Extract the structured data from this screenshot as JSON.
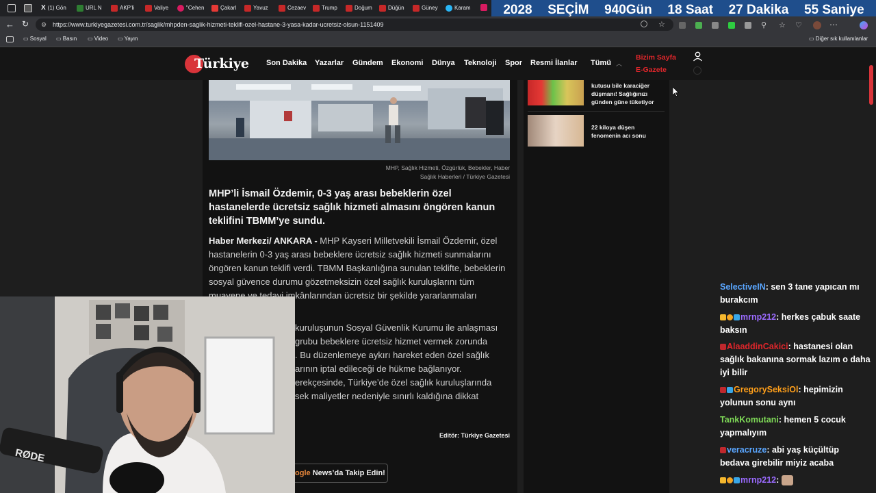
{
  "browser": {
    "tabs": [
      "(1) Gön",
      "URL N",
      "AKP'li",
      "Valiye",
      "\"Cehen",
      "Çakarl",
      "Yavuz",
      "Cezaev",
      "Trump",
      "Doğum",
      "Düğün",
      "Güney",
      "Karam"
    ],
    "url": "https://www.turkiyegazetesi.com.tr/saglik/mhpden-saglik-hizmeti-teklifi-ozel-hastane-3-yasa-kadar-ucretsiz-olsun-1151409",
    "bookmarks": [
      "Sosyal",
      "Basın",
      "Video",
      "Yayın"
    ],
    "other_bookmarks": "Diğer sık kullanılanlar"
  },
  "countdown": {
    "year": "2028",
    "label": "SEÇİM",
    "days": "940",
    "days_unit": "Gün",
    "hours": "18",
    "hours_unit": "Saat",
    "minutes": "27",
    "minutes_unit": "Dakika",
    "seconds": "55",
    "seconds_unit": "Saniye"
  },
  "site": {
    "logo": "Türkiye",
    "nav": [
      "Son Dakika",
      "Yazarlar",
      "Gündem",
      "Ekonomi",
      "Dünya",
      "Teknoloji",
      "Spor",
      "Resmi İlanlar",
      "Tümü"
    ],
    "bizim_sayfa": "Bizim Sayfa",
    "egazete": "E-Gazete"
  },
  "article": {
    "caption_line1": "MHP, Sağlık Hizmeti, Özgürlük, Bebekler, Haber",
    "caption_line2": "Sağlık Haberleri  / Türkiye Gazetesi",
    "lead": "MHP’li İsmail Özdemir, 0-3 yaş arası bebeklerin özel hastanelerde ücretsiz sağlık hizmeti almasını öngören kanun teklifini TBMM’ye sundu.",
    "dateline": "Haber Merkezi/ ANKARA - ",
    "body1": "MHP Kayseri Milletvekili İsmail Özdemir, özel hastanelerin 0-3 yaş arası bebeklere ücretsiz sağlık hizmeti sunmalarını öngören kanun teklifi verdi. TBMM Başkanlığına sunulan teklifte, bebeklerin sosyal güvence durumu gözetmeksizin özel sağlık kuruluşlarını tüm muayene ve tedavi imkânlarından ücretsiz bir şekilde yararlanmaları",
    "body2_lines": [
      "kuruluşunun Sosyal Güvenlik Kurumu ile anlaşması",
      "grubu bebeklere ücretsiz hizmet vermek zorunda",
      ". Bu düzenlemeye aykırı hareket eden özel sağlık",
      "arının iptal edileceği de hükme bağlanıyor.",
      "erekçesinde, Türkiye’de özel sağlık kuruluşlarında",
      "sek maliyetler nedeniyle sınırlı kaldığına dikkat"
    ],
    "editor": "Editör: Türkiye Gazetesi",
    "google_news_prefix": "ogle",
    "google_news_suffix": "News’da Takip Edin!"
  },
  "sidebar": {
    "items": [
      {
        "title": "kutusu bile karaciğer düşmanı! Sağlığınızı günden güne tüketiyor"
      },
      {
        "title": "22 kiloya düşen fenomenin acı sonu"
      }
    ]
  },
  "webcam": {
    "mic_brand": "RØDE"
  },
  "chat": [
    {
      "user": "SelectiveIN",
      "color": "#5aa6ff",
      "message": "sen 3 tane yapıcan mı burakcım"
    },
    {
      "user": "mrnp212",
      "color": "#9b6bff",
      "message": "herkes çabuk saate baksın"
    },
    {
      "user": "AlaaddinCakici",
      "color": "#e0262b",
      "message": "hastanesi olan sağlık bakanına sormak lazım o daha iyi bilir"
    },
    {
      "user": "GregorySeksiOl",
      "color": "#ff9f1a",
      "message": "hepimizin yolunun sonu aynı"
    },
    {
      "user": "TankKomutani",
      "color": "#7ed957",
      "message": "hemen 5 cocuk yapmalıyım"
    },
    {
      "user": "veracruze",
      "color": "#5aa6ff",
      "message": "abi yaş küçültüp bedava girebilir miyiz acaba"
    },
    {
      "user": "mrnp212",
      "color": "#9b6bff",
      "message": ""
    }
  ]
}
